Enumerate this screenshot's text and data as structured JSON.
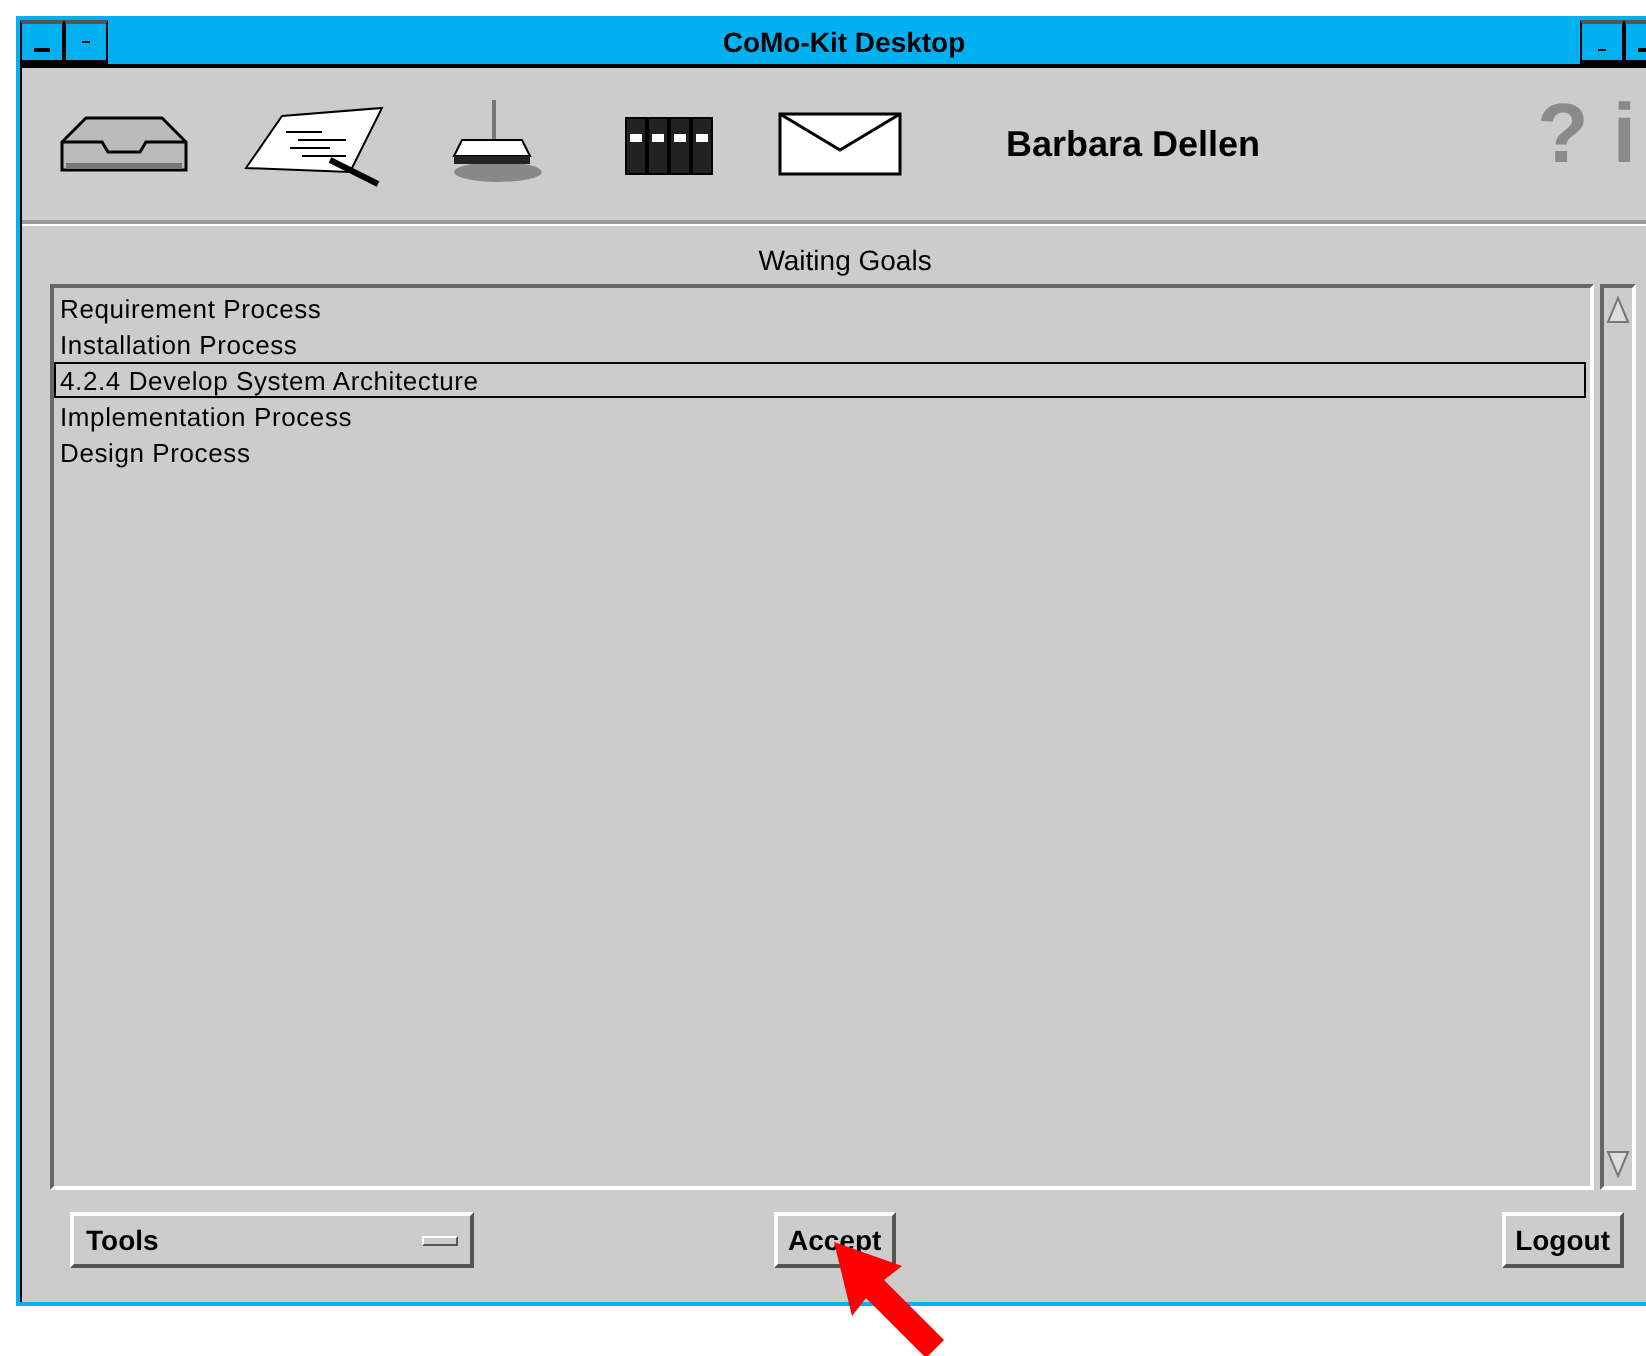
{
  "window": {
    "title": "CoMo-Kit Desktop"
  },
  "toolbar": {
    "user": "Barbara Dellen",
    "help_glyphs": [
      "?",
      "i"
    ]
  },
  "list": {
    "title": "Waiting Goals",
    "items": [
      {
        "label": "Requirement Process",
        "selected": false
      },
      {
        "label": "Installation Process",
        "selected": false
      },
      {
        "label": "4.2.4 Develop System Architecture",
        "selected": true
      },
      {
        "label": "Implementation Process",
        "selected": false
      },
      {
        "label": "Design Process",
        "selected": false
      }
    ]
  },
  "tools_menu": {
    "value": "Tools"
  },
  "buttons": [
    {
      "label": "Accept",
      "kind": "center"
    },
    {
      "label": "Logout",
      "kind": "right"
    }
  ]
}
